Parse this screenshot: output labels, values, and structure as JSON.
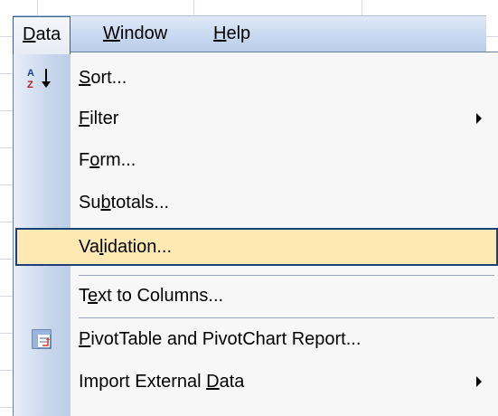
{
  "menubar": {
    "data": {
      "prefix": "",
      "underline": "D",
      "rest": "ata"
    },
    "window": {
      "prefix": "",
      "underline": "W",
      "rest": "indow"
    },
    "help": {
      "prefix": "",
      "underline": "H",
      "rest": "elp"
    }
  },
  "menu": {
    "items": [
      {
        "prefix": "",
        "underline": "S",
        "rest": "ort...",
        "icon": "sort-ascending-icon"
      },
      {
        "prefix": "",
        "underline": "F",
        "rest": "ilter",
        "submenu": true
      },
      {
        "prefix": "F",
        "underline": "o",
        "rest": "rm..."
      },
      {
        "prefix": "Su",
        "underline": "b",
        "rest": "totals..."
      },
      {
        "prefix": "Va",
        "underline": "l",
        "rest": "idation...",
        "highlighted": true
      },
      {
        "prefix": "T",
        "underline": "e",
        "rest": "xt to Columns..."
      },
      {
        "prefix": "",
        "underline": "P",
        "rest": "ivotTable and PivotChart Report...",
        "icon": "pivot-table-icon"
      },
      {
        "prefix": "Import External ",
        "underline": "D",
        "rest": "ata",
        "submenu": true
      }
    ]
  },
  "colors": {
    "highlight_fill": "#ffe9b3",
    "highlight_border": "#1f3f78",
    "menubar": "#c9d9f1"
  }
}
